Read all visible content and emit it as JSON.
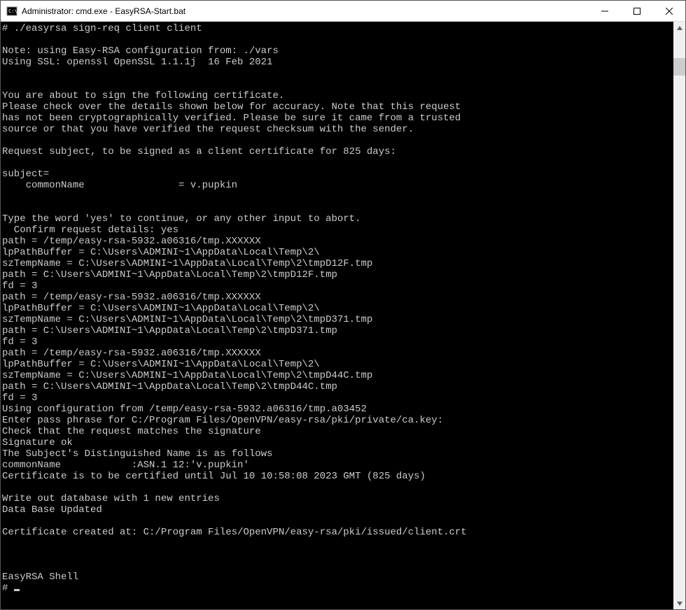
{
  "window": {
    "title": "Administrator: cmd.exe - EasyRSA-Start.bat"
  },
  "terminal": {
    "lines": [
      "# ./easyrsa sign-req client client",
      "",
      "Note: using Easy-RSA configuration from: ./vars",
      "Using SSL: openssl OpenSSL 1.1.1j  16 Feb 2021",
      "",
      "",
      "You are about to sign the following certificate.",
      "Please check over the details shown below for accuracy. Note that this request",
      "has not been cryptographically verified. Please be sure it came from a trusted",
      "source or that you have verified the request checksum with the sender.",
      "",
      "Request subject, to be signed as a client certificate for 825 days:",
      "",
      "subject=",
      "    commonName                = v.pupkin",
      "",
      "",
      "Type the word 'yes' to continue, or any other input to abort.",
      "  Confirm request details: yes",
      "path = /temp/easy-rsa-5932.a06316/tmp.XXXXXX",
      "lpPathBuffer = C:\\Users\\ADMINI~1\\AppData\\Local\\Temp\\2\\",
      "szTempName = C:\\Users\\ADMINI~1\\AppData\\Local\\Temp\\2\\tmpD12F.tmp",
      "path = C:\\Users\\ADMINI~1\\AppData\\Local\\Temp\\2\\tmpD12F.tmp",
      "fd = 3",
      "path = /temp/easy-rsa-5932.a06316/tmp.XXXXXX",
      "lpPathBuffer = C:\\Users\\ADMINI~1\\AppData\\Local\\Temp\\2\\",
      "szTempName = C:\\Users\\ADMINI~1\\AppData\\Local\\Temp\\2\\tmpD371.tmp",
      "path = C:\\Users\\ADMINI~1\\AppData\\Local\\Temp\\2\\tmpD371.tmp",
      "fd = 3",
      "path = /temp/easy-rsa-5932.a06316/tmp.XXXXXX",
      "lpPathBuffer = C:\\Users\\ADMINI~1\\AppData\\Local\\Temp\\2\\",
      "szTempName = C:\\Users\\ADMINI~1\\AppData\\Local\\Temp\\2\\tmpD44C.tmp",
      "path = C:\\Users\\ADMINI~1\\AppData\\Local\\Temp\\2\\tmpD44C.tmp",
      "fd = 3",
      "Using configuration from /temp/easy-rsa-5932.a06316/tmp.a03452",
      "Enter pass phrase for C:/Program Files/OpenVPN/easy-rsa/pki/private/ca.key:",
      "Check that the request matches the signature",
      "Signature ok",
      "The Subject's Distinguished Name is as follows",
      "commonName            :ASN.1 12:'v.pupkin'",
      "Certificate is to be certified until Jul 10 10:58:08 2023 GMT (825 days)",
      "",
      "Write out database with 1 new entries",
      "Data Base Updated",
      "",
      "Certificate created at: C:/Program Files/OpenVPN/easy-rsa/pki/issued/client.crt",
      "",
      "",
      "",
      "EasyRSA Shell"
    ],
    "prompt": "# "
  }
}
